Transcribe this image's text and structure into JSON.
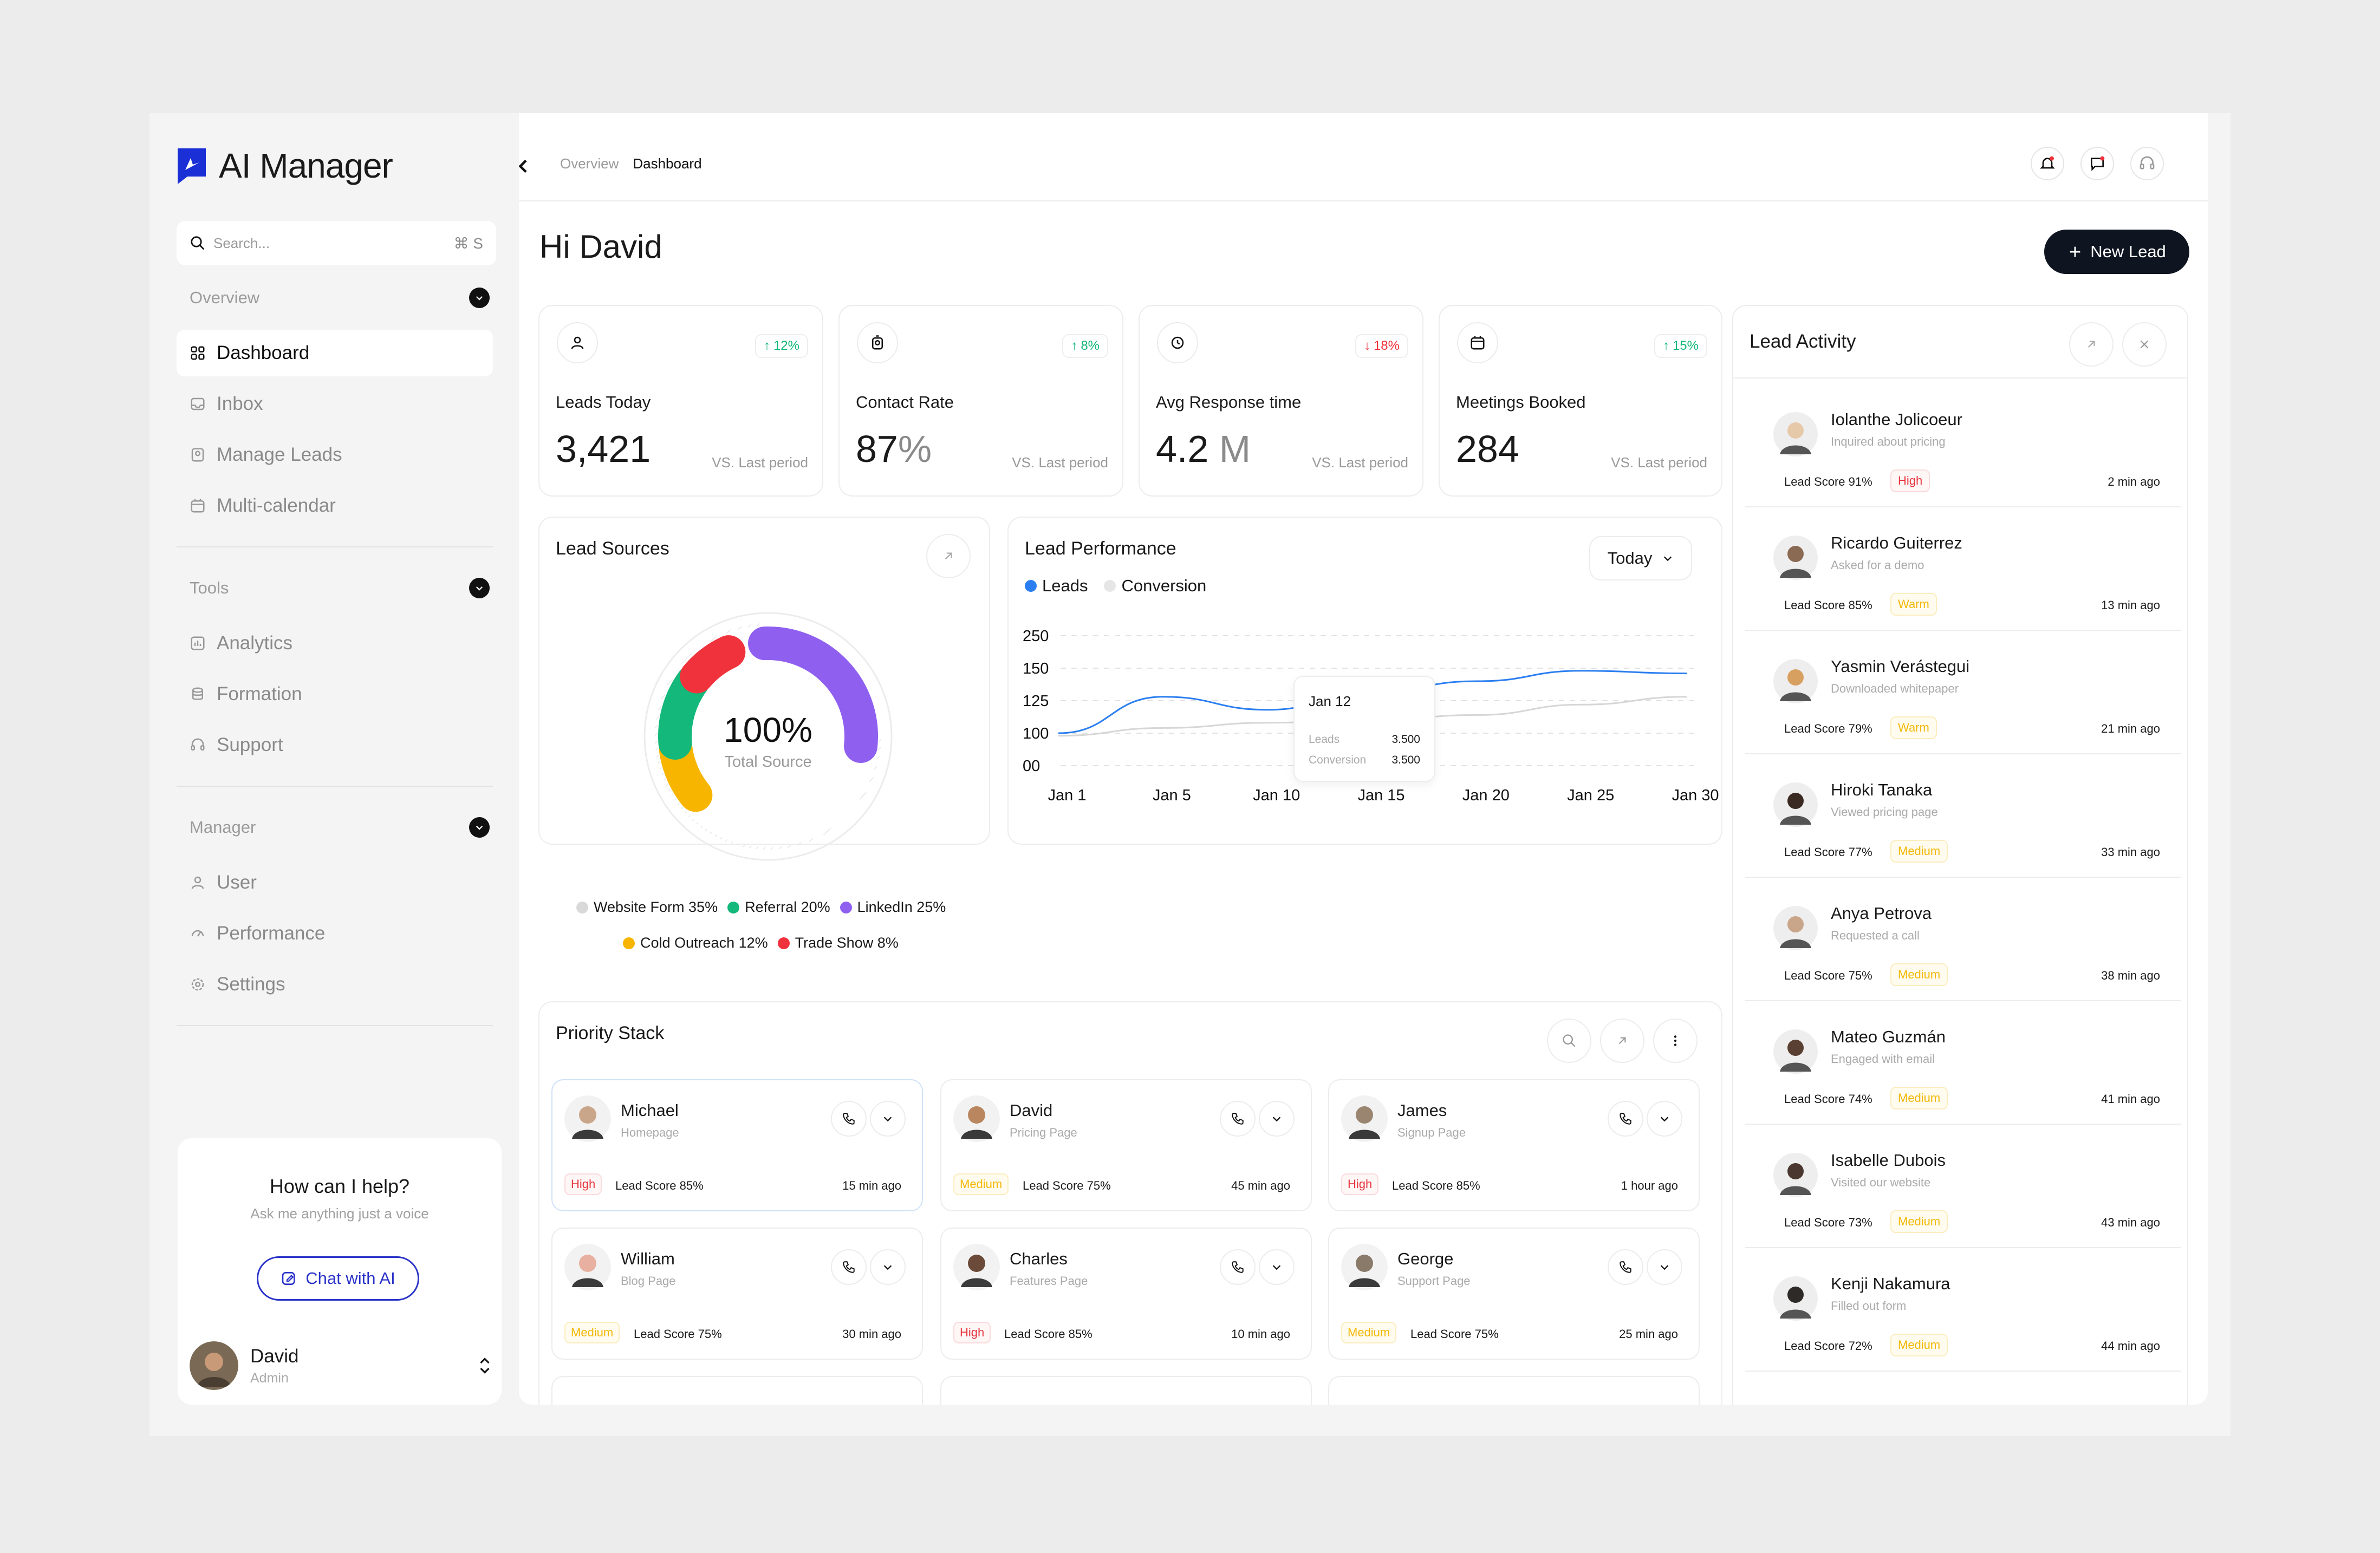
{
  "app": {
    "title": "AI Manager",
    "accent": "#1a2fd6"
  },
  "search": {
    "placeholder": "Search...",
    "shortcut": "⌘ S"
  },
  "sidebar": {
    "overview": {
      "heading": "Overview",
      "items": [
        {
          "label": "Dashboard",
          "icon": "grid-icon",
          "active": true
        },
        {
          "label": "Inbox",
          "icon": "inbox-icon"
        },
        {
          "label": "Manage Leads",
          "icon": "leads-icon"
        },
        {
          "label": "Multi-calendar",
          "icon": "calendar-icon"
        }
      ]
    },
    "tools": {
      "heading": "Tools",
      "items": [
        {
          "label": "Analytics",
          "icon": "analytics-icon"
        },
        {
          "label": "Formation",
          "icon": "database-icon"
        },
        {
          "label": "Support",
          "icon": "headset-icon"
        }
      ]
    },
    "manager": {
      "heading": "Manager",
      "items": [
        {
          "label": "User",
          "icon": "user-icon"
        },
        {
          "label": "Performance",
          "icon": "performance-icon"
        },
        {
          "label": "Settings",
          "icon": "settings-icon"
        }
      ]
    }
  },
  "help": {
    "title": "How can I help?",
    "subtitle": "Ask me anything just a voice",
    "button": "Chat with AI"
  },
  "profile": {
    "name": "David",
    "role": "Admin"
  },
  "breadcrumb": {
    "parent": "Overview",
    "current": "Dashboard"
  },
  "greeting": "Hi David",
  "new_lead_label": "New Lead",
  "kpis": [
    {
      "label": "Leads Today",
      "value": "3,421",
      "unit": "",
      "delta": "12%",
      "direction": "up",
      "vs": "VS. Last period",
      "icon": "user-icon"
    },
    {
      "label": "Contact Rate",
      "value": "87",
      "unit": "%",
      "delta": "8%",
      "direction": "up",
      "vs": "VS. Last period",
      "icon": "badge-icon"
    },
    {
      "label": "Avg Response time",
      "value": "4.2",
      "unit": "M",
      "delta": "18%",
      "direction": "down",
      "vs": "VS. Last period",
      "icon": "clock-icon"
    },
    {
      "label": "Meetings Booked",
      "value": "284",
      "unit": "",
      "delta": "15%",
      "direction": "up",
      "vs": "VS. Last period",
      "icon": "calendar-icon"
    }
  ],
  "lead_sources": {
    "title": "Lead Sources",
    "center_value": "100%",
    "center_label": "Total Source",
    "legend": [
      {
        "label": "Website Form 35%",
        "color": "#d9d9d9"
      },
      {
        "label": "Referral 20%",
        "color": "#14b87a"
      },
      {
        "label": "LinkedIn 25%",
        "color": "#8f5ff0"
      },
      {
        "label": "Cold Outreach 12%",
        "color": "#f7b500"
      },
      {
        "label": "Trade Show 8%",
        "color": "#f0323c"
      }
    ]
  },
  "lead_performance": {
    "title": "Lead Performance",
    "range": "Today",
    "tooltip": {
      "date": "Jan 12",
      "leads_label": "Leads",
      "leads_value": "3.500",
      "conv_label": "Conversion",
      "conv_value": "3.500"
    }
  },
  "chart_data": {
    "type": "line",
    "title": "Lead Performance",
    "x": [
      "Jan 1",
      "Jan 5",
      "Jan 10",
      "Jan 15",
      "Jan 20",
      "Jan 25",
      "Jan 30"
    ],
    "y_ticks": [
      "250",
      "150",
      "125",
      "100",
      "00"
    ],
    "series": [
      {
        "name": "Leads",
        "color": "#2a7ef0",
        "values": [
          100,
          128,
          118,
          132,
          140,
          148,
          146
        ]
      },
      {
        "name": "Conversion",
        "color": "#dedede",
        "values": [
          92,
          104,
          108,
          110,
          114,
          122,
          128
        ]
      }
    ],
    "legend_position": "top-left",
    "grid": true
  },
  "priority_stack": {
    "title": "Priority Stack",
    "cards": [
      {
        "name": "Michael",
        "page": "Homepage",
        "priority": "High",
        "score": "Lead Score 85%",
        "time": "15 min ago"
      },
      {
        "name": "David",
        "page": "Pricing Page",
        "priority": "Medium",
        "score": "Lead Score 75%",
        "time": "45 min ago"
      },
      {
        "name": "James",
        "page": "Signup Page",
        "priority": "High",
        "score": "Lead Score 85%",
        "time": "1 hour ago"
      },
      {
        "name": "William",
        "page": "Blog Page",
        "priority": "Medium",
        "score": "Lead Score 75%",
        "time": "30 min ago"
      },
      {
        "name": "Charles",
        "page": "Features Page",
        "priority": "High",
        "score": "Lead Score 85%",
        "time": "10 min ago"
      },
      {
        "name": "George",
        "page": "Support Page",
        "priority": "Medium",
        "score": "Lead Score 75%",
        "time": "25 min ago"
      }
    ]
  },
  "lead_activity": {
    "title": "Lead Activity",
    "items": [
      {
        "name": "Iolanthe Jolicoeur",
        "desc": "Inquired about pricing",
        "score": "Lead Score 91%",
        "tag": "High",
        "time": "2 min ago"
      },
      {
        "name": "Ricardo Guiterrez",
        "desc": "Asked for a demo",
        "score": "Lead Score 85%",
        "tag": "Warm",
        "time": "13 min ago"
      },
      {
        "name": "Yasmin Verástegui",
        "desc": "Downloaded whitepaper",
        "score": "Lead Score 79%",
        "tag": "Warm",
        "time": "21 min ago"
      },
      {
        "name": "Hiroki Tanaka",
        "desc": "Viewed pricing page",
        "score": "Lead Score 77%",
        "tag": "Medium",
        "time": "33 min ago"
      },
      {
        "name": "Anya Petrova",
        "desc": "Requested a call",
        "score": "Lead Score 75%",
        "tag": "Medium",
        "time": "38 min ago"
      },
      {
        "name": "Mateo Guzmán",
        "desc": "Engaged with email",
        "score": "Lead Score 74%",
        "tag": "Medium",
        "time": "41 min ago"
      },
      {
        "name": "Isabelle Dubois",
        "desc": "Visited our website",
        "score": "Lead Score 73%",
        "tag": "Medium",
        "time": "43 min ago"
      },
      {
        "name": "Kenji Nakamura",
        "desc": "Filled out form",
        "score": "Lead Score 72%",
        "tag": "Medium",
        "time": "44 min ago"
      }
    ]
  }
}
